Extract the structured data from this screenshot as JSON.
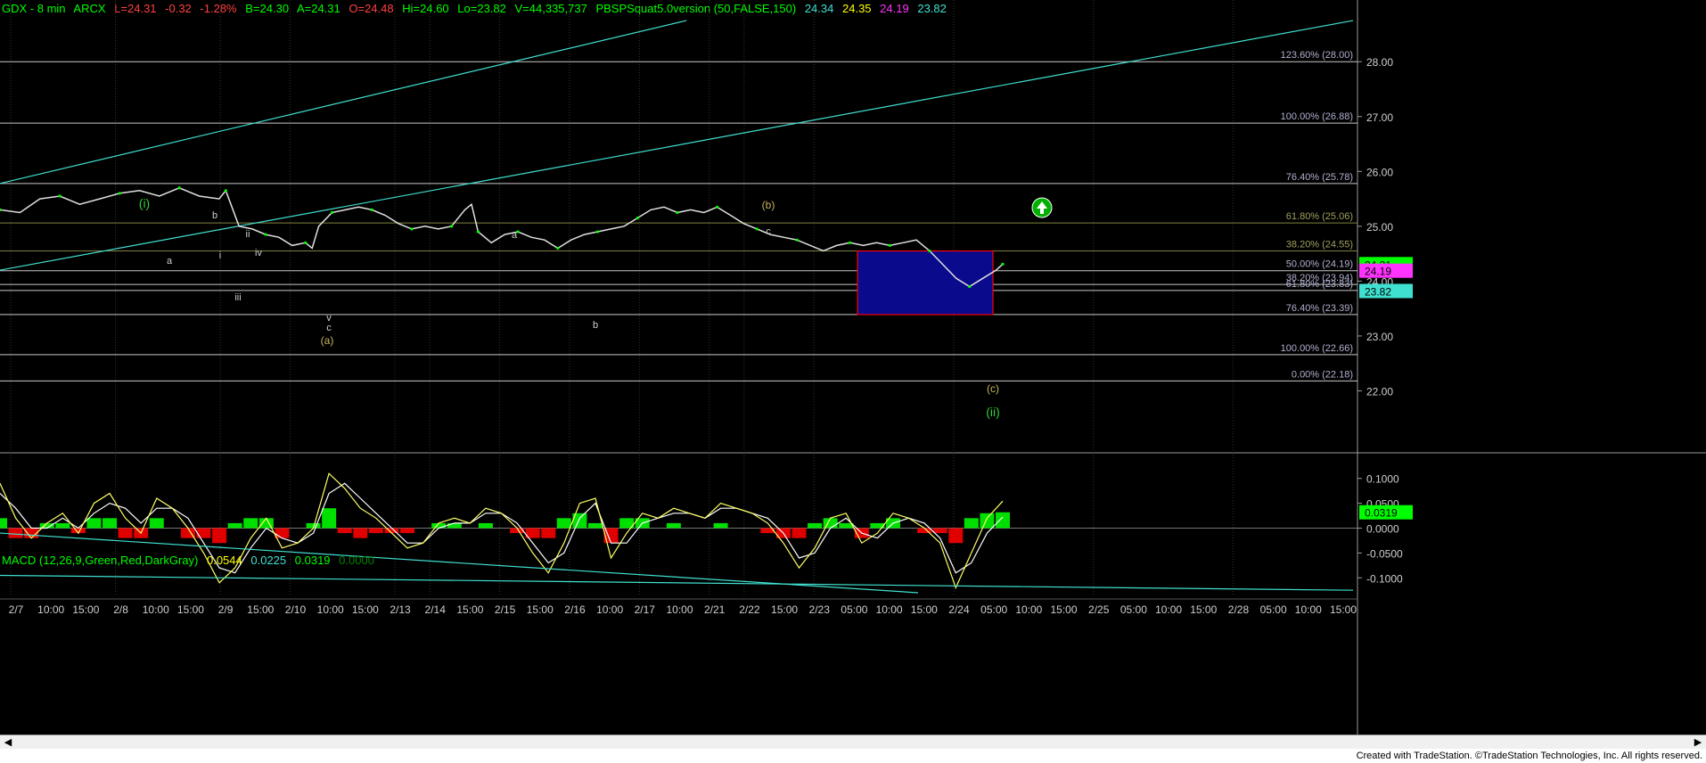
{
  "header": {
    "symbol": "GDX - 8 min",
    "exchange": "ARCX",
    "last": "L=24.31",
    "change": "-0.32",
    "pct": "-1.28%",
    "bid": "B=24.30",
    "ask": "A=24.31",
    "open": "O=24.48",
    "high": "Hi=24.60",
    "low": "Lo=23.82",
    "volume": "V=44,335,737",
    "study": "PBSPSquat5.0version (50,FALSE,150)",
    "v1": "24.34",
    "v2": "24.35",
    "v3": "24.19",
    "v4": "23.82"
  },
  "macd_header": {
    "label": "MACD (12,26,9,Green,Red,DarkGray)",
    "v1": "0.0544",
    "v2": "0.0225",
    "v3": "0.0319",
    "v4": "0.0000"
  },
  "footer": {
    "text": "Created with TradeStation. ©TradeStation Technologies, Inc. All rights reserved."
  },
  "colors": {
    "green": "#00ff00",
    "yellow": "#ffff66",
    "cyan": "#40e0d0",
    "magenta": "#ff33ff",
    "fib": "#c8c8c8",
    "fib_olive": "#808040",
    "box_fill": "#0a0a8c",
    "box_border": "#ff0000",
    "price_line": "#e0e0e0",
    "label_green": "#33cc33",
    "label_gold": "#c8b460"
  },
  "chart_data": [
    {
      "type": "line",
      "title": "GDX - 8 min",
      "x_ticks": [
        "2/7",
        "10:00",
        "15:00",
        "2/8",
        "10:00",
        "15:00",
        "2/9",
        "15:00",
        "2/10",
        "10:00",
        "15:00",
        "2/13",
        "2/14",
        "15:00",
        "2/15",
        "15:00",
        "2/16",
        "10:00",
        "2/17",
        "10:00",
        "2/21",
        "2/22",
        "15:00",
        "2/23",
        "05:00",
        "10:00",
        "15:00",
        "2/24",
        "05:00",
        "10:00",
        "15:00",
        "2/25",
        "05:00",
        "10:00",
        "15:00",
        "2/28",
        "05:00",
        "10:00",
        "15:00"
      ],
      "y_ticks": [
        "28.00",
        "27.00",
        "26.00",
        "25.00",
        "24.00",
        "23.00",
        "22.00"
      ],
      "ylim": [
        21.0,
        28.8
      ],
      "last_price": "24.31",
      "price_series": {
        "name": "GDX",
        "points": [
          [
            0,
            25.3
          ],
          [
            3,
            25.25
          ],
          [
            6,
            25.5
          ],
          [
            9,
            25.55
          ],
          [
            12,
            25.4
          ],
          [
            15,
            25.5
          ],
          [
            18,
            25.6
          ],
          [
            21,
            25.65
          ],
          [
            24,
            25.55
          ],
          [
            27,
            25.7
          ],
          [
            30,
            25.55
          ],
          [
            33,
            25.5
          ],
          [
            34,
            25.65
          ],
          [
            36,
            25.0
          ],
          [
            38,
            24.95
          ],
          [
            40,
            24.85
          ],
          [
            42,
            24.8
          ],
          [
            44,
            24.65
          ],
          [
            46,
            24.7
          ],
          [
            47,
            24.6
          ],
          [
            48,
            25.0
          ],
          [
            50,
            25.25
          ],
          [
            52,
            25.3
          ],
          [
            54,
            25.35
          ],
          [
            56,
            25.3
          ],
          [
            58,
            25.2
          ],
          [
            60,
            25.05
          ],
          [
            62,
            24.95
          ],
          [
            64,
            25.0
          ],
          [
            66,
            24.95
          ],
          [
            68,
            25.0
          ],
          [
            70,
            25.3
          ],
          [
            71,
            25.4
          ],
          [
            72,
            24.9
          ],
          [
            74,
            24.7
          ],
          [
            76,
            24.85
          ],
          [
            78,
            24.9
          ],
          [
            80,
            24.8
          ],
          [
            82,
            24.75
          ],
          [
            84,
            24.6
          ],
          [
            86,
            24.75
          ],
          [
            88,
            24.85
          ],
          [
            90,
            24.9
          ],
          [
            92,
            24.95
          ],
          [
            94,
            25.0
          ],
          [
            96,
            25.15
          ],
          [
            98,
            25.3
          ],
          [
            100,
            25.35
          ],
          [
            102,
            25.25
          ],
          [
            104,
            25.3
          ],
          [
            106,
            25.25
          ],
          [
            108,
            25.35
          ],
          [
            110,
            25.2
          ],
          [
            112,
            25.05
          ],
          [
            114,
            24.95
          ],
          [
            116,
            24.85
          ],
          [
            118,
            24.8
          ],
          [
            120,
            24.75
          ],
          [
            124,
            24.55
          ],
          [
            126,
            24.65
          ],
          [
            128,
            24.7
          ],
          [
            130,
            24.65
          ],
          [
            132,
            24.7
          ],
          [
            134,
            24.65
          ],
          [
            136,
            24.7
          ],
          [
            138,
            24.75
          ],
          [
            140,
            24.55
          ],
          [
            142,
            24.3
          ],
          [
            144,
            24.05
          ],
          [
            146,
            23.9
          ],
          [
            148,
            24.05
          ],
          [
            150,
            24.2
          ],
          [
            151,
            24.31
          ]
        ]
      },
      "wave_labels": [
        "(i)",
        "a",
        "b",
        "i",
        "ii",
        "iv",
        "iii",
        "v",
        "c",
        "(a)",
        "a",
        "b",
        "(b)",
        "c",
        "(c)",
        "(ii)"
      ],
      "fib_levels": [
        {
          "label": "123.60% (28.00)",
          "price": 28.0
        },
        {
          "label": "100.00% (26.88)",
          "price": 26.88
        },
        {
          "label": "76.40% (25.78)",
          "price": 25.78
        },
        {
          "label": "61.80% (25.06)",
          "price": 25.06
        },
        {
          "label": "38.20% (24.55)",
          "price": 24.55
        },
        {
          "label": "50.00% (24.19)",
          "price": 24.19
        },
        {
          "label": "38.20% (23.94)",
          "price": 23.94
        },
        {
          "label": "61.80% (23.83)",
          "price": 23.83
        },
        {
          "label": "76.40% (23.39)",
          "price": 23.39
        },
        {
          "label": "100.00% (22.66)",
          "price": 22.66
        },
        {
          "label": "0.00% (22.18)",
          "price": 22.18
        }
      ],
      "price_tags": [
        {
          "text": "24.31",
          "price": 24.31,
          "color": "#00ff00"
        },
        {
          "text": "24.19",
          "price": 24.19,
          "color": "#ff33ff"
        },
        {
          "text": "23.82",
          "price": 23.82,
          "color": "#40e0d0"
        }
      ]
    },
    {
      "type": "line",
      "title": "MACD (12,26,9,Green,Red,DarkGray)",
      "y_ticks": [
        "0.1000",
        "0.0500",
        "0.0000",
        "-0.0500",
        "-0.1000"
      ],
      "ylim": [
        -0.13,
        0.13
      ],
      "last_value": "0.0319",
      "series": [
        {
          "name": "MACD",
          "values": [
            0.09,
            0.02,
            -0.02,
            0.01,
            0.03,
            -0.01,
            0.05,
            0.07,
            0.02,
            -0.01,
            0.06,
            0.04,
            0.0,
            -0.05,
            -0.11,
            -0.08,
            -0.02,
            0.02,
            -0.04,
            -0.03,
            0.0,
            0.11,
            0.08,
            0.04,
            0.02,
            -0.01,
            -0.04,
            -0.03,
            0.01,
            0.02,
            0.01,
            0.04,
            0.03,
            0.0,
            -0.05,
            -0.09,
            -0.03,
            0.05,
            0.06,
            -0.06,
            -0.01,
            0.03,
            0.02,
            0.04,
            0.03,
            0.02,
            0.05,
            0.04,
            0.03,
            0.01,
            -0.03,
            -0.08,
            -0.04,
            0.02,
            0.03,
            -0.03,
            -0.01,
            0.03,
            0.02,
            0.0,
            -0.03,
            -0.12,
            -0.05,
            0.02,
            0.0544
          ]
        },
        {
          "name": "Signal",
          "values": [
            0.07,
            0.04,
            0.0,
            0.0,
            0.02,
            0.0,
            0.03,
            0.05,
            0.04,
            0.01,
            0.04,
            0.04,
            0.02,
            -0.03,
            -0.08,
            -0.09,
            -0.04,
            0.0,
            -0.02,
            -0.03,
            -0.01,
            0.07,
            0.09,
            0.06,
            0.03,
            0.0,
            -0.03,
            -0.03,
            0.0,
            0.01,
            0.01,
            0.03,
            0.03,
            0.01,
            -0.03,
            -0.07,
            -0.05,
            0.02,
            0.05,
            -0.03,
            -0.03,
            0.01,
            0.02,
            0.03,
            0.03,
            0.02,
            0.04,
            0.04,
            0.03,
            0.02,
            -0.01,
            -0.06,
            -0.05,
            0.0,
            0.02,
            -0.01,
            -0.02,
            0.01,
            0.02,
            0.01,
            -0.02,
            -0.09,
            -0.07,
            -0.01,
            0.0225
          ]
        }
      ]
    }
  ]
}
